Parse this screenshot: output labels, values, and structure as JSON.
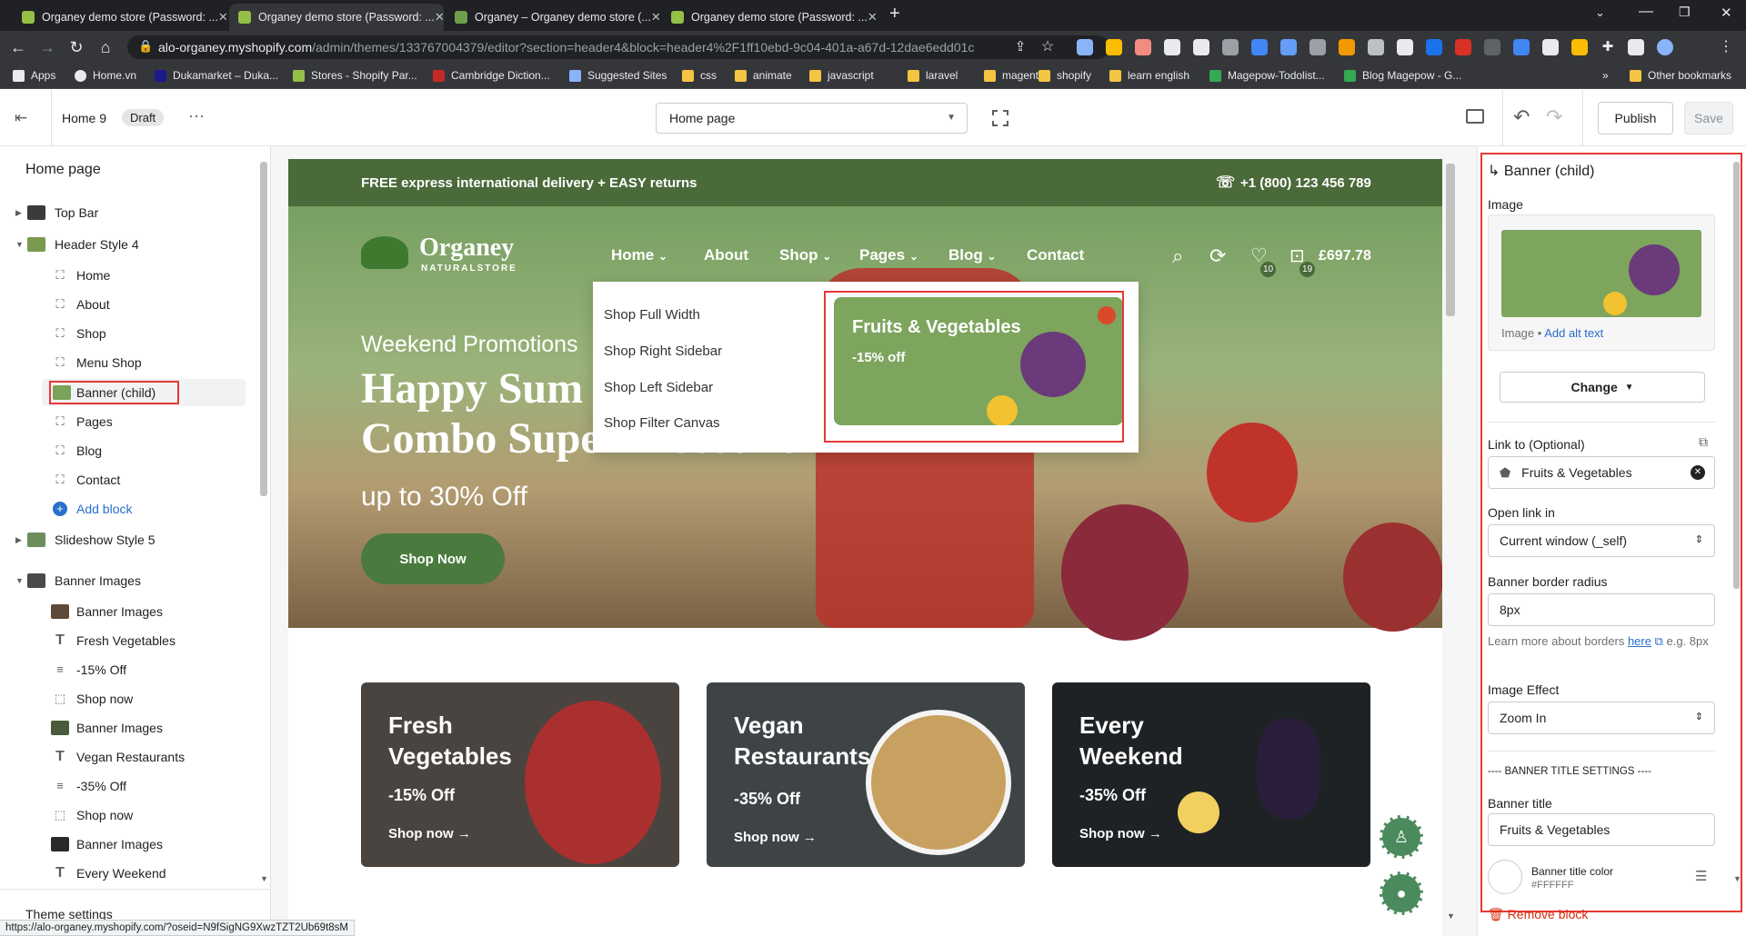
{
  "browser": {
    "tabs": [
      {
        "title": "Organey demo store (Password: ...",
        "active": false
      },
      {
        "title": "Organey demo store (Password: ...",
        "active": true
      },
      {
        "title": "Organey – Organey demo store (...",
        "active": false
      },
      {
        "title": "Organey demo store (Password: ...",
        "active": false
      }
    ],
    "url_host": "alo-organey.myshopify.com",
    "url_path": "/admin/themes/133767004379/editor?section=header4&block=header4%2F1ff10ebd-9c04-401a-a67d-12dae6edd01c",
    "bookmarks": [
      "Apps",
      "Home.vn",
      "Dukamarket – Duka...",
      "Stores - Shopify Par...",
      "Cambridge Diction...",
      "Suggested Sites",
      "css",
      "animate",
      "javascript",
      "laravel",
      "magento",
      "shopify",
      "learn english",
      "Magepow-Todolist...",
      "Blog Magepow - G..."
    ],
    "other_bookmarks": "Other bookmarks",
    "status_url": "https://alo-organey.myshopify.com/?oseid=N9fSigNG9XwzTZT2Ub69t8sM"
  },
  "editor": {
    "theme_name": "Home 9",
    "draft_badge": "Draft",
    "page_select": "Home page",
    "publish": "Publish",
    "save": "Save"
  },
  "left_panel": {
    "title": "Home page",
    "items": [
      {
        "label": "Top Bar"
      },
      {
        "label": "Header Style 4"
      },
      {
        "label": "Home"
      },
      {
        "label": "About"
      },
      {
        "label": "Shop"
      },
      {
        "label": "Menu Shop"
      },
      {
        "label": "Banner (child)"
      },
      {
        "label": "Pages"
      },
      {
        "label": "Blog"
      },
      {
        "label": "Contact"
      },
      {
        "label": "Add block"
      },
      {
        "label": "Slideshow Style 5"
      },
      {
        "label": "Banner Images"
      },
      {
        "label": "Banner Images"
      },
      {
        "label": "Fresh Vegetables"
      },
      {
        "label": "-15% Off"
      },
      {
        "label": "Shop now"
      },
      {
        "label": "Banner Images"
      },
      {
        "label": "Vegan Restaurants"
      },
      {
        "label": "-35% Off"
      },
      {
        "label": "Shop now"
      },
      {
        "label": "Banner Images"
      },
      {
        "label": "Every Weekend"
      }
    ],
    "theme_settings": "Theme settings"
  },
  "store": {
    "announcement": "FREE express international delivery + EASY returns",
    "phone": "+1 (800) 123 456 789",
    "logo_main": "Organey",
    "logo_sub": "NATURALSTORE",
    "menu": [
      "Home",
      "About",
      "Shop",
      "Pages",
      "Blog",
      "Contact"
    ],
    "wishlist_count": "10",
    "cart_count": "19",
    "cart_total": "£697.78",
    "dropdown": [
      "Shop Full Width",
      "Shop Right Sidebar",
      "Shop Left Sidebar",
      "Shop Filter Canvas"
    ],
    "dropdown_banner_title": "Fruits & Vegetables",
    "dropdown_banner_sub": "-15% off",
    "hero_pre": "Weekend Promotions",
    "hero_title_1": "Happy Sum",
    "hero_title_2": "Combo Super Discount",
    "hero_sub": "up to 30% Off",
    "hero_button": "Shop Now",
    "cards": [
      {
        "title": "Fresh Vegetables",
        "off": "-15% Off",
        "link": "Shop now →"
      },
      {
        "title": "Vegan Restaurants",
        "off": "-35% Off",
        "link": "Shop now →"
      },
      {
        "title": "Every Weekend",
        "off": "-35% Off",
        "link": "Shop now →"
      }
    ]
  },
  "right_panel": {
    "title": "Banner (child)",
    "image_label": "Image",
    "image_caption": "Image",
    "alt_text_link": "Add alt text",
    "change_button": "Change",
    "link_label": "Link to (Optional)",
    "link_value": "Fruits & Vegetables",
    "open_in_label": "Open link in",
    "open_in_value": "Current window (_self)",
    "radius_label": "Banner border radius",
    "radius_value": "8px",
    "learn_more_pre": "Learn more about borders",
    "learn_more_link": "here",
    "learn_more_post": "e.g. 8px",
    "effect_label": "Image Effect",
    "effect_value": "Zoom In",
    "section_heading": "---- BANNER TITLE SETTINGS ----",
    "banner_title_label": "Banner title",
    "banner_title_value": "Fruits & Vegetables",
    "title_color_label": "Banner title color",
    "title_color_value": "#FFFFFF",
    "remove_block": "Remove block"
  },
  "colors": {
    "brand_green": "#4b6a3a",
    "highlight_red": "#e53935",
    "link_blue": "#2c6ecb"
  }
}
